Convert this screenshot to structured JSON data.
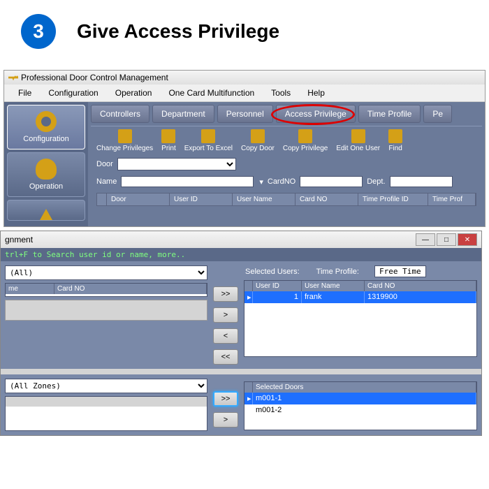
{
  "step": {
    "number": "3",
    "title": "Give Access Privilege"
  },
  "app": {
    "title": "Professional Door Control Management",
    "menu": [
      "File",
      "Configuration",
      "Operation",
      "One Card Multifunction",
      "Tools",
      "Help"
    ],
    "sidebar": [
      {
        "label": "Configuration"
      },
      {
        "label": "Operation"
      }
    ],
    "tabs": [
      "Controllers",
      "Department",
      "Personnel",
      "Access Privilege",
      "Time Profile",
      "Pe"
    ],
    "tools": [
      "Change Privileges",
      "Print",
      "Export To Excel",
      "Copy Door",
      "Copy Privilege",
      "Edit One User",
      "Find"
    ],
    "filters": {
      "door_label": "Door",
      "name_label": "Name",
      "cardno_label": "CardNO",
      "dept_label": "Dept."
    },
    "grid_cols": [
      "Door",
      "User ID",
      "User Name",
      "Card NO",
      "Time Profile ID",
      "Time Prof"
    ]
  },
  "dialog": {
    "title_suffix": "gnment",
    "hint": "trl+F  to Search user id or name,  more..",
    "left_combo": "(All)",
    "left_cols": [
      "me",
      "Card NO"
    ],
    "selected_users_label": "Selected Users:",
    "time_profile_label": "Time Profile:",
    "time_profile_value": "Free Time",
    "user_cols": [
      "User ID",
      "User Name",
      "Card NO"
    ],
    "user_row": {
      "id": "1",
      "name": "frank",
      "card": "1319900"
    },
    "zones_combo": "(All Zones)",
    "selected_doors_label": "Selected Doors",
    "door_rows": [
      "m001-1",
      "m001-2"
    ],
    "arrows": {
      "add_all": ">>",
      "add": ">",
      "rm": "<",
      "rm_all": "<<"
    }
  }
}
